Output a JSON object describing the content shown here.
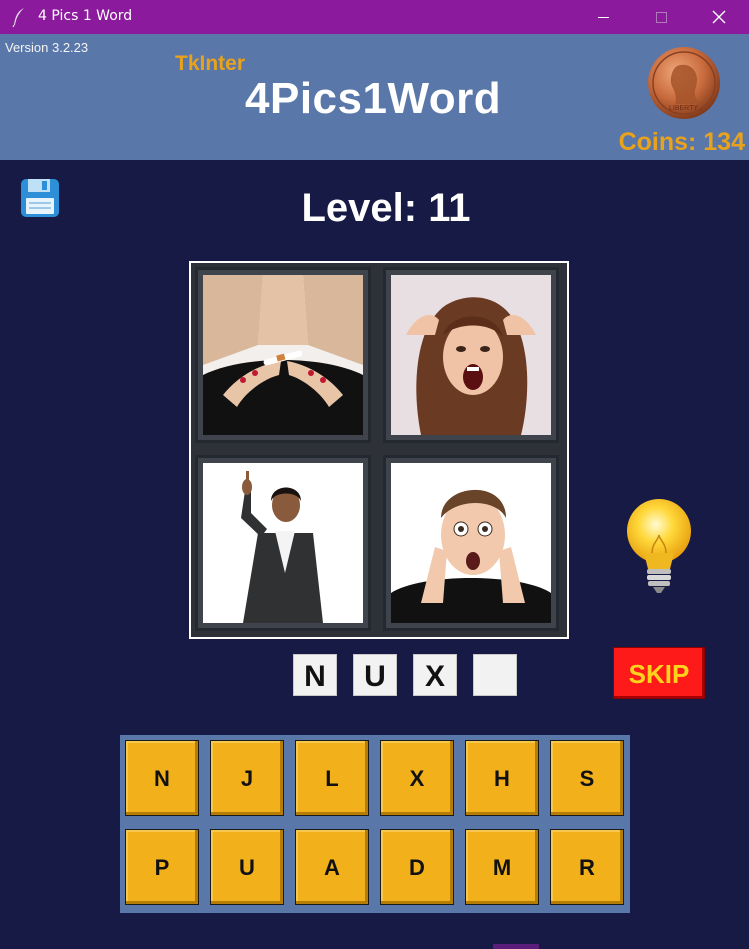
{
  "window": {
    "title": "4 Pics 1 Word",
    "controls": {
      "minimize_icon": "minimize-icon",
      "maximize_icon": "maximize-icon",
      "close_icon": "close-icon"
    }
  },
  "header": {
    "version": "Version 3.2.23",
    "subtitle": "TkInter",
    "title": "4Pics1Word",
    "coins_label": "Coins: 134",
    "coin_icon": "penny-coin-icon"
  },
  "level_label": "Level: 11",
  "pictures": [
    {
      "name": "picture-breaking-cigarette"
    },
    {
      "name": "picture-screaming-woman"
    },
    {
      "name": "picture-businesswoman-pointing"
    },
    {
      "name": "picture-shocked-man"
    }
  ],
  "answer_slots": [
    "N",
    "U",
    "X",
    ""
  ],
  "skip_label": "SKIP",
  "letters": {
    "row1": [
      "N",
      "J",
      "L",
      "X",
      "H",
      "S"
    ],
    "row2": [
      "P",
      "U",
      "A",
      "D",
      "M",
      "R"
    ]
  },
  "colors": {
    "titlebar": "#8b1a9c",
    "header": "#5a77aa",
    "background": "#161a44",
    "accent_gold": "#e8a21c",
    "key": "#f2b01a",
    "skip": "#ff1a1a"
  }
}
